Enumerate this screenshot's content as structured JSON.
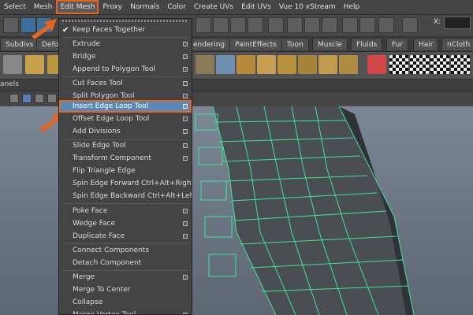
{
  "menubar": {
    "items": [
      "Select",
      "Mesh",
      "Edit Mesh",
      "Proxy",
      "Normals",
      "Color",
      "Create UVs",
      "Edit UVs",
      "Vue 10 xStream",
      "Help"
    ],
    "active_index": 2
  },
  "toolbar": {
    "x_label": "X:"
  },
  "shelf_tabs": [
    "Subdivs",
    "Defo",
    "endering",
    "PaintEffects",
    "Toon",
    "Muscle",
    "Fluids",
    "Fur",
    "Hair",
    "nCloth"
  ],
  "panels_label": "anels",
  "menu": {
    "title": "Edit Mesh",
    "items": [
      {
        "label": "Keep Faces Together",
        "checked": true,
        "option": false
      },
      {
        "label": "Extrude",
        "option": true
      },
      {
        "label": "Bridge",
        "option": true
      },
      {
        "label": "Append to Polygon Tool",
        "option": true
      },
      {
        "label": "Cut Faces Tool",
        "option": true
      },
      {
        "label": "Split Polygon Tool",
        "option": true
      },
      {
        "label": "Insert Edge Loop Tool",
        "option": true,
        "highlighted": true
      },
      {
        "label": "Offset Edge Loop Tool",
        "option": true
      },
      {
        "label": "Add Divisions",
        "option": true
      },
      {
        "label": "Slide Edge Tool",
        "option": true
      },
      {
        "label": "Transform Component",
        "option": true
      },
      {
        "label": "Flip Triangle Edge",
        "option": false
      },
      {
        "label": "Spin Edge Forward  Ctrl+Alt+Right",
        "option": false
      },
      {
        "label": "Spin Edge Backward  Ctrl+Alt+Left",
        "option": false
      },
      {
        "label": "Poke Face",
        "option": true
      },
      {
        "label": "Wedge Face",
        "option": true
      },
      {
        "label": "Duplicate Face",
        "option": true
      },
      {
        "label": "Connect Components",
        "option": false
      },
      {
        "label": "Detach Component",
        "option": false
      },
      {
        "label": "Merge",
        "option": true
      },
      {
        "label": "Merge To Center",
        "option": false
      },
      {
        "label": "Collapse",
        "option": false
      },
      {
        "label": "Merge Vertex Tool",
        "option": true
      }
    ]
  },
  "colors": {
    "highlight_outline": "#e6641e",
    "menu_highlight": "#5889b8",
    "wireframe": "#3fe39a"
  }
}
